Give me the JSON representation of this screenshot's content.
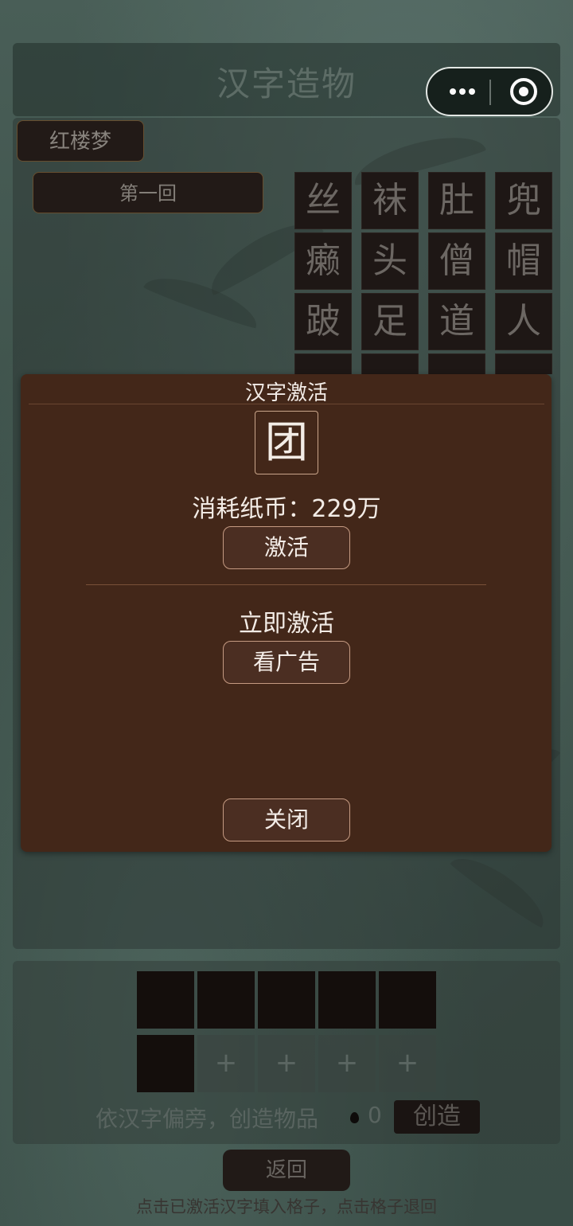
{
  "app": {
    "title": "汉字造物"
  },
  "capsule": {
    "more_icon": "more-dots-icon",
    "close_icon": "target-close-icon"
  },
  "book": {
    "name": "红楼梦"
  },
  "chapter": {
    "name": "第一回"
  },
  "char_grid": {
    "rows": [
      [
        "丝",
        "袜",
        "肚",
        "兜"
      ],
      [
        "癞",
        "头",
        "僧",
        "帽"
      ],
      [
        "跛",
        "足",
        "道",
        "人"
      ],
      [
        "",
        "",
        "",
        ""
      ]
    ]
  },
  "craft": {
    "slot_plus": "+",
    "hint": "依汉字偏旁，创造物品",
    "drop_count": "0",
    "create_label": "创造"
  },
  "back_label": "返回",
  "footer_hint": "点击已激活汉字填入格子，点击格子退回",
  "modal": {
    "title": "汉字激活",
    "character": "团",
    "cost_text": "消耗纸币：229万",
    "activate_label": "激活",
    "instant_label": "立即激活",
    "ad_label": "看广告",
    "close_label": "关闭"
  }
}
